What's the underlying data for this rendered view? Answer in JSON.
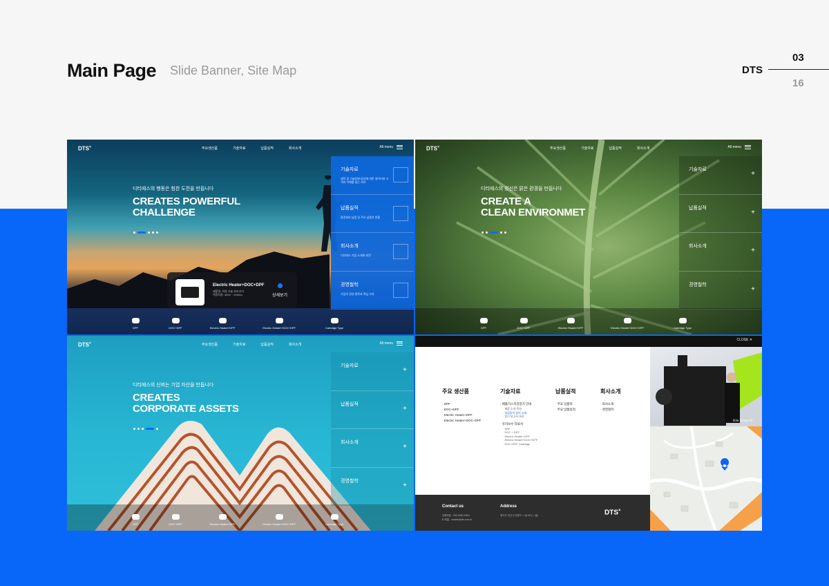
{
  "header": {
    "title": "Main Page",
    "subtitle": "Slide Banner, Site Map",
    "brand": "DTS",
    "page_current": "03",
    "page_total": "16"
  },
  "colors": {
    "accent": "#0867f8",
    "background": "#f6f6f6"
  },
  "site": {
    "logo": "DTS",
    "logo_mark": "×",
    "nav": [
      "주요생산품",
      "기술자료",
      "납품실적",
      "회사소개"
    ],
    "all_menu": "All menu"
  },
  "slides": [
    {
      "kicker": "디티에스의 행동은 힘찬 도전을 만듭니다",
      "headline": [
        "CREATES POWERFUL",
        "CHALLENGE"
      ],
      "side_items": [
        {
          "label": "기술자료",
          "desc": "제작 및 기술동향/검사에 대한 데이터와 고객의 이해를 돕는 자료"
        },
        {
          "label": "납품실적",
          "desc": "환경설비 납품 및 주요 납품처 현황"
        },
        {
          "label": "회사소개",
          "desc": "디티에스 기업 소개와 비전"
        },
        {
          "label": "경영철학",
          "desc": "기업의 경영 철학과 핵심 가치"
        }
      ],
      "popup": {
        "name": "Electric Heater+DOC+DPF",
        "spec1": "제품명: 차량 기술 보조기기",
        "spec2": "적용차량: 3000 ~ 5000cc",
        "more": "상세보기"
      }
    },
    {
      "kicker": "디티에스의 정신은 맑은 환경을 만듭니다",
      "headline": [
        "CREATE A",
        "CLEAN ENVIRONMET"
      ],
      "side_items": [
        {
          "label": "기술자료"
        },
        {
          "label": "납품실적"
        },
        {
          "label": "회사소개"
        },
        {
          "label": "경영철학"
        }
      ]
    },
    {
      "kicker": "디티에스의 신뢰는 기업 자산을 만듭니다",
      "headline": [
        "CREATES",
        "CORPORATE ASSETS"
      ],
      "side_items": [
        {
          "label": "기술자료"
        },
        {
          "label": "납품실적"
        },
        {
          "label": "회사소개"
        },
        {
          "label": "경영철학"
        }
      ]
    }
  ],
  "products": [
    "DPF",
    "DOC+DPF",
    "Electric Heater+DPF",
    "Electric Heater+DOC+DPF",
    "Cartridge Type"
  ],
  "sitemap": {
    "close": "CLOSE",
    "columns": [
      {
        "title": "주요 생산품",
        "items": [
          "· DPF",
          "· DOC+DPF",
          "· Electric Heater+DPF",
          "· Electric Heater+DOC+DPF"
        ]
      },
      {
        "title": "기술자료",
        "items": [
          "· 배출가스저감장치 안내"
        ],
        "subs": [
          "· 제품 소개 목차",
          "· 저감장치 원리 소개",
          "· 정기 보고서 자료"
        ],
        "items2": [
          "· 유지보수 자료서"
        ],
        "subs2": [
          "· DPF",
          "· DOC + DPF",
          "· Electric Heater+DPF",
          "· Electric Heater+DOC+DPF",
          "· DOC+DPF Cartridge"
        ]
      },
      {
        "title": "납품실적",
        "items": [
          "· 주요 납품처",
          "· 주요 납품실적"
        ]
      },
      {
        "title": "회사소개",
        "items": [
          "· 회사소개",
          "· 경영철학"
        ]
      }
    ],
    "contact_title": "Contact us",
    "contact_tel": "전화번호 : 000-0000-0000",
    "contact_mail": "E-메일 : master@dts.com.kr",
    "address_title": "Address",
    "address": "경기도 안산시 단원구 ○○로 00 (○○동)",
    "footer_logo": "DTS",
    "ceo_sign": "Kim Young Sil"
  }
}
